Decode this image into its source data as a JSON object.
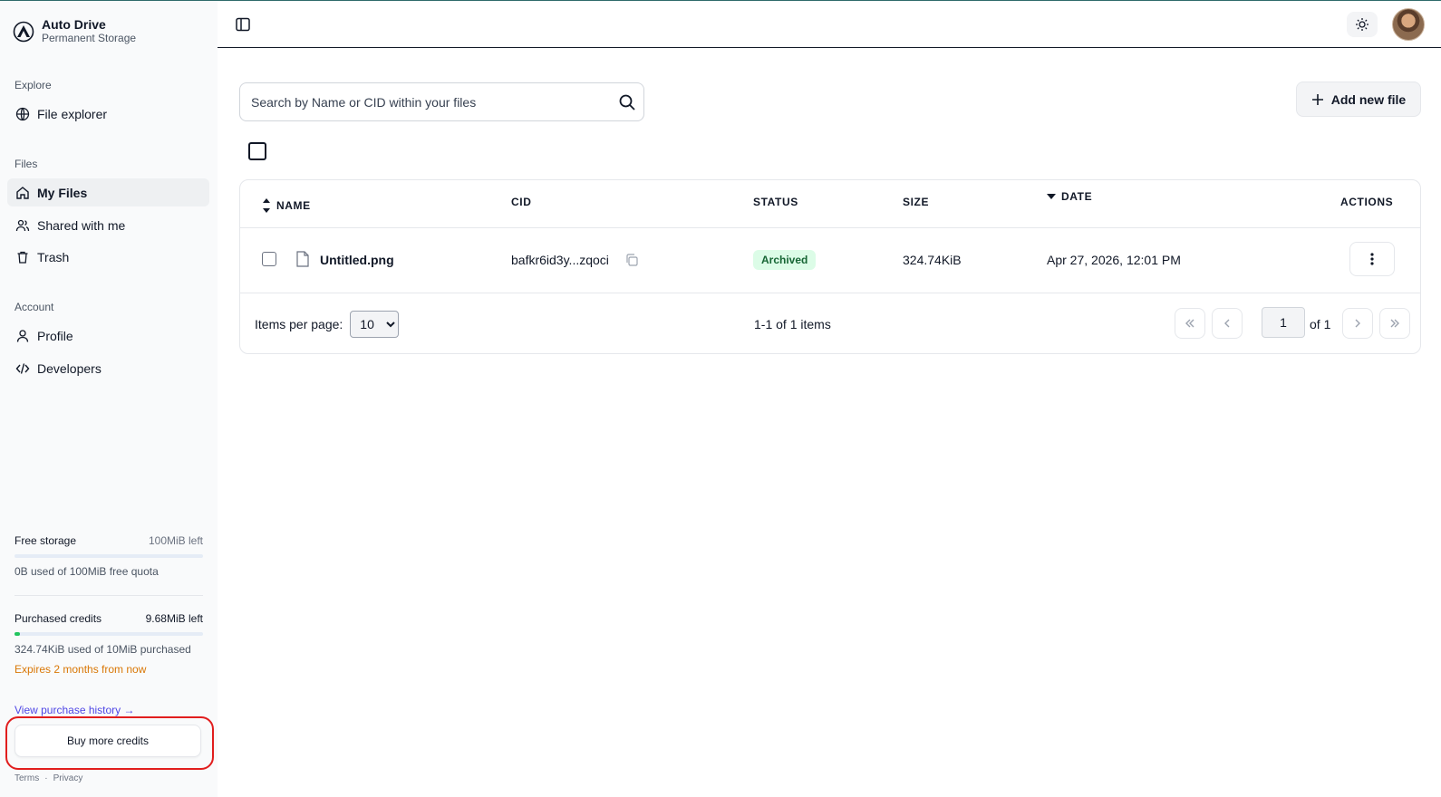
{
  "brand": {
    "title": "Auto Drive",
    "subtitle": "Permanent Storage"
  },
  "sidebar": {
    "sections": [
      {
        "label": "Explore",
        "items": [
          {
            "label": "File explorer",
            "icon": "globe-icon"
          }
        ]
      },
      {
        "label": "Files",
        "items": [
          {
            "label": "My Files",
            "icon": "home-icon",
            "active": true
          },
          {
            "label": "Shared with me",
            "icon": "users-icon"
          },
          {
            "label": "Trash",
            "icon": "trash-icon"
          }
        ]
      },
      {
        "label": "Account",
        "items": [
          {
            "label": "Profile",
            "icon": "user-icon"
          },
          {
            "label": "Developers",
            "icon": "code-icon"
          }
        ]
      }
    ],
    "free_storage": {
      "title": "Free storage",
      "left": "100MiB left",
      "used_fraction": 0,
      "note": "0B used of 100MiB free quota"
    },
    "purchased": {
      "title": "Purchased credits",
      "left": "9.68MiB left",
      "used_fraction": 0.03,
      "note": "324.74KiB used of 10MiB purchased",
      "expires": "Expires 2 months from now"
    },
    "history_link": "View purchase history →",
    "buy_button": "Buy more credits",
    "footer": {
      "terms": "Terms",
      "separator": "·",
      "privacy": "Privacy"
    }
  },
  "header": {
    "theme_icon": "sun-icon",
    "sidebar_toggle_icon": "panel-left-icon"
  },
  "main": {
    "search_placeholder": "Search by Name or CID within your files",
    "add_button": "Add new file",
    "table": {
      "columns": {
        "name": "NAME",
        "cid": "CID",
        "status": "STATUS",
        "size": "SIZE",
        "date": "DATE",
        "actions": "ACTIONS"
      },
      "rows": [
        {
          "name": "Untitled.png",
          "cid": "bafkr6id3y...zqoci",
          "status": "Archived",
          "size": "324.74KiB",
          "date": "Apr 27, 2026, 12:01 PM"
        }
      ]
    },
    "pagination": {
      "items_per_page_label": "Items per page:",
      "items_per_page": "10",
      "range_text": "1-1 of 1 items",
      "page": "1",
      "of_text": "of 1"
    }
  },
  "colors": {
    "accent_link": "#4f46e5",
    "success": "#22c55e",
    "warning": "#d97706",
    "highlight": "#e11d1d"
  }
}
